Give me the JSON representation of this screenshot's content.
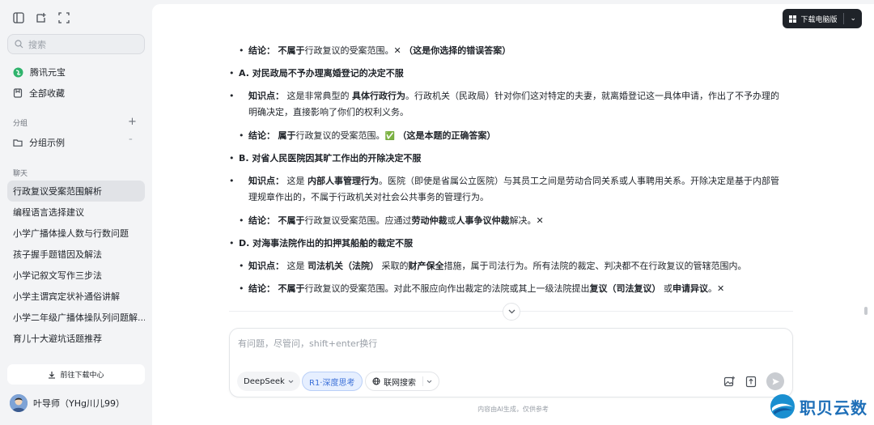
{
  "sidebar": {
    "icons": [
      "sidebar-toggle-icon",
      "new-chat-icon",
      "screenshot-icon"
    ],
    "search_placeholder": "搜索",
    "app_name": "腾讯元宝",
    "favorites": "全部收藏",
    "group_section": "分组",
    "group_example": "分组示例",
    "chat_section": "聊天",
    "chats": [
      "行政复议受案范围解析",
      "编程语言选择建议",
      "小学广播体操人数与行数问题",
      "孩子握手题错因及解法",
      "小学记叙文写作三步法",
      "小学主谓宾定状补通俗讲解",
      "小学二年级广播体操队列问题解...",
      "育儿十大避坑话题推荐"
    ],
    "download_center": "前往下载中心",
    "user_name": "叶导师（YHg川儿99）"
  },
  "header": {
    "download_pc": "下载电脑版"
  },
  "content": {
    "l1": {
      "label": "结论：",
      "b1": "不属于",
      "t1": "行政复议的受案范围。",
      "mark": "✕",
      "tail": "（这是你选择的错误答案）"
    },
    "a_head": "A. 对民政局不予办理离婚登记的决定不服",
    "a_k": {
      "label": "知识点：",
      "t1": "这是非常典型的",
      "b1": "具体行政行为",
      "t2": "。行政机关（民政局）针对你们这对特定的夫妻，就离婚登记这一具体申请，作出了不予办理的明确决定，直接影响了你们的权利义务。"
    },
    "a_c": {
      "label": "结论：",
      "b1": "属于",
      "t1": "行政复议的受案范围。",
      "mark": "✅",
      "tail": "（这是本题的正确答案）"
    },
    "b_head": "B. 对省人民医院因其旷工作出的开除决定不服",
    "b_k": {
      "label": "知识点：",
      "t1": "这是",
      "b1": "内部人事管理行为",
      "t2": "。医院（即使是省属公立医院）与其员工之间是劳动合同关系或人事聘用关系。开除决定是基于内部管理规章作出的，不属于行政机关对社会公共事务的管理行为。"
    },
    "b_c": {
      "label": "结论：",
      "b1": "不属于",
      "t1": "行政复议受案范围。应通过",
      "b2": "劳动仲裁",
      "t2": "或",
      "b3": "人事争议仲裁",
      "t3": "解决。",
      "mark": "✕"
    },
    "d_head": "D. 对海事法院作出的扣押其船舶的裁定不服",
    "d_k": {
      "label": "知识点：",
      "t1": "这是",
      "b1": "司法机关（法院）",
      "t2": "采取的",
      "b2": "财产保全",
      "t3": "措施，属于司法行为。所有法院的裁定、判决都不在行政复议的管辖范围内。"
    },
    "d_c": {
      "label": "结论：",
      "b1": "不属于",
      "t1": "行政复议的受案范围。对此不服应向作出裁定的法院或其上一级法院提出",
      "b2": "复议（司法复议）",
      "t2": "或",
      "b3": "申请异议",
      "t3": "。",
      "mark": "✕"
    }
  },
  "composer": {
    "placeholder": "有问题，尽管问，shift+enter换行",
    "model": "DeepSeek",
    "deep_think": "R1·深度思考",
    "web_search": "联网搜索",
    "footnote": "内容由AI生成，仅供参考"
  },
  "watermark": {
    "text": "职贝云数"
  },
  "colors": {
    "accent": "#3a6fd8",
    "dark_button": "#1f2329",
    "sidebar_bg": "#f3f4f6"
  }
}
